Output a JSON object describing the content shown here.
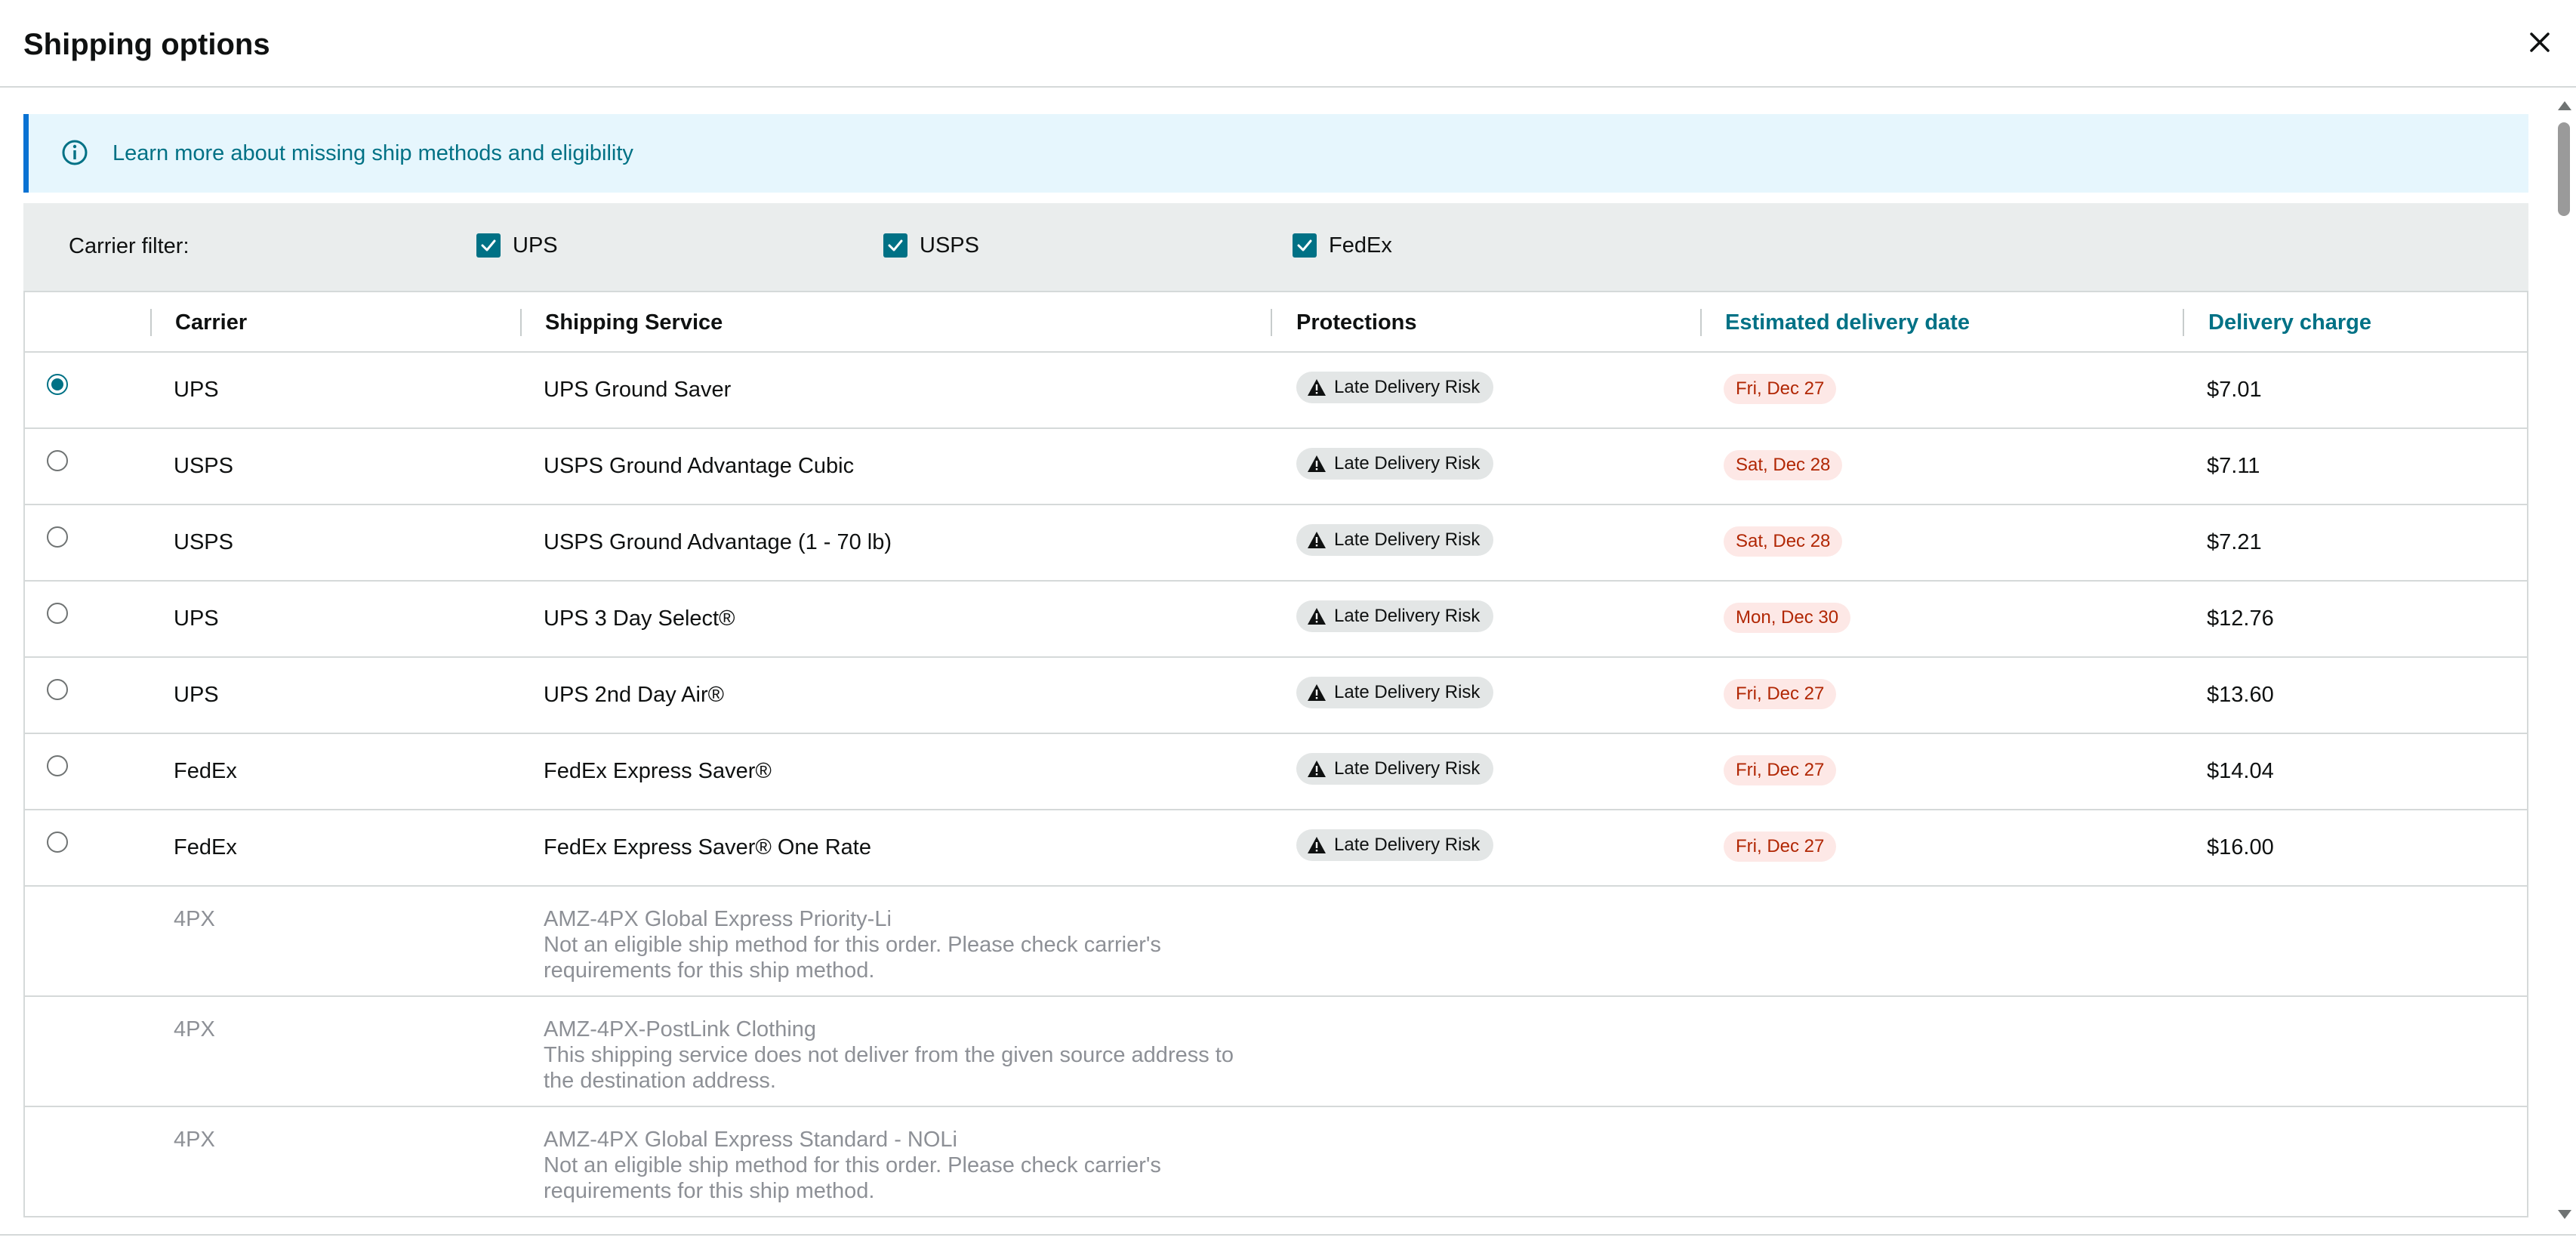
{
  "dialog": {
    "title": "Shipping options",
    "close_icon": "close-icon"
  },
  "banner": {
    "icon": "info-icon",
    "link_text": "Learn more about missing ship methods and eligibility"
  },
  "filter": {
    "label": "Carrier filter:",
    "options": [
      {
        "label": "UPS",
        "checked": true
      },
      {
        "label": "USPS",
        "checked": true
      },
      {
        "label": "FedEx",
        "checked": true
      }
    ]
  },
  "table": {
    "columns": {
      "carrier": "Carrier",
      "service": "Shipping Service",
      "protections": "Protections",
      "delivery_date": "Estimated delivery date",
      "charge": "Delivery charge"
    },
    "rows": [
      {
        "selected": true,
        "carrier": "UPS",
        "service": "UPS Ground Saver",
        "protection": "Late Delivery Risk",
        "date": "Fri, Dec 27",
        "charge": "$7.01"
      },
      {
        "selected": false,
        "carrier": "USPS",
        "service": "USPS Ground Advantage Cubic",
        "protection": "Late Delivery Risk",
        "date": "Sat, Dec 28",
        "charge": "$7.11"
      },
      {
        "selected": false,
        "carrier": "USPS",
        "service": "USPS Ground Advantage (1 - 70 lb)",
        "protection": "Late Delivery Risk",
        "date": "Sat, Dec 28",
        "charge": "$7.21"
      },
      {
        "selected": false,
        "carrier": "UPS",
        "service": "UPS 3 Day Select®",
        "protection": "Late Delivery Risk",
        "date": "Mon, Dec 30",
        "charge": "$12.76"
      },
      {
        "selected": false,
        "carrier": "UPS",
        "service": "UPS 2nd Day Air®",
        "protection": "Late Delivery Risk",
        "date": "Fri, Dec 27",
        "charge": "$13.60"
      },
      {
        "selected": false,
        "carrier": "FedEx",
        "service": "FedEx Express Saver®",
        "protection": "Late Delivery Risk",
        "date": "Fri, Dec 27",
        "charge": "$14.04"
      },
      {
        "selected": false,
        "carrier": "FedEx",
        "service": "FedEx Express Saver® One Rate",
        "protection": "Late Delivery Risk",
        "date": "Fri, Dec 27",
        "charge": "$16.00"
      }
    ],
    "ineligible": [
      {
        "carrier": "4PX",
        "service": "AMZ-4PX Global Express Priority-Li",
        "reason": "Not an eligible ship method for this order. Please check carrier's requirements for this ship method."
      },
      {
        "carrier": "4PX",
        "service": "AMZ-4PX-PostLink Clothing",
        "reason": "This shipping service does not deliver from the given source address to the destination address."
      },
      {
        "carrier": "4PX",
        "service": "AMZ-4PX Global Express Standard - NOLi",
        "reason": "Not an eligible ship method for this order. Please check carrier's requirements for this ship method."
      }
    ]
  },
  "colors": {
    "accent": "#007185",
    "banner_bg": "#e6f6fd",
    "banner_border": "#0972d3",
    "date_badge_bg": "#fde8e6",
    "date_badge_text": "#b12704",
    "muted_text": "#8d9096"
  }
}
